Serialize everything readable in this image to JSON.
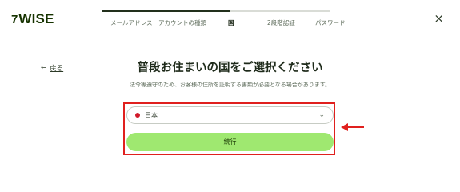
{
  "brand": {
    "flag_glyph": "7",
    "name": "WISE"
  },
  "steps": [
    {
      "label": "メールアドレス",
      "state": "done"
    },
    {
      "label": "アカウントの種類",
      "state": "done"
    },
    {
      "label": "国",
      "state": "active"
    },
    {
      "label": "2段階認証",
      "state": "todo"
    },
    {
      "label": "パスワード",
      "state": "todo"
    }
  ],
  "close_glyph": "×",
  "back": {
    "arrow": "←",
    "label": "戻る"
  },
  "title": "普段お住まいの国をご選択ください",
  "subtitle": "法令等遵守のため、お客様の住所を証明する書類が必要となる場合があります。",
  "country_select": {
    "value": "日本",
    "chevron": "⌄"
  },
  "continue_label": "続行",
  "colors": {
    "accent": "#9fe870",
    "highlight": "#e0201e",
    "brand": "#163300"
  }
}
